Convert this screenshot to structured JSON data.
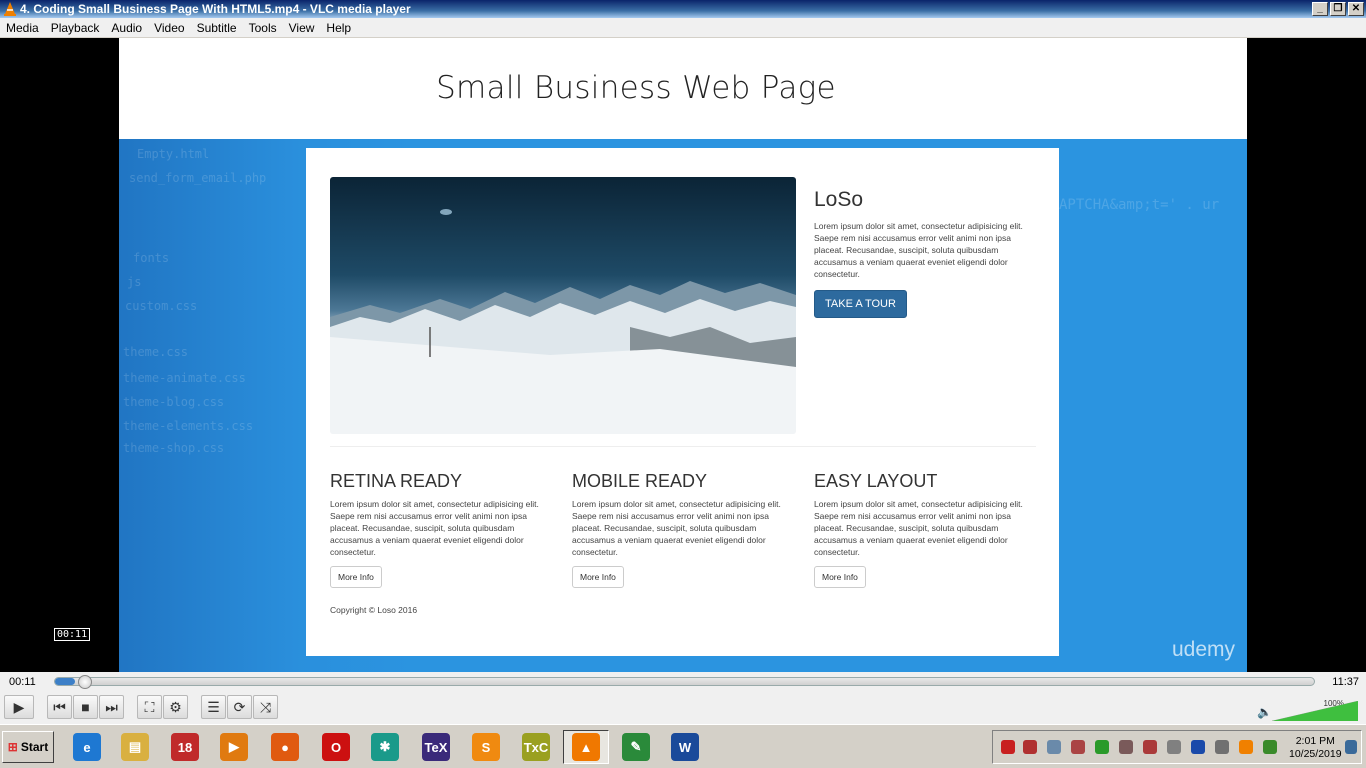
{
  "window": {
    "title": "4. Coding Small Business Page With HTML5.mp4 - VLC media player",
    "buttons": [
      "_",
      "❐",
      "✕"
    ]
  },
  "menu": [
    "Media",
    "Playback",
    "Audio",
    "Video",
    "Subtitle",
    "Tools",
    "View",
    "Help"
  ],
  "video": {
    "header_title": "Small Business Web Page",
    "watermark": "udemy",
    "hero": {
      "heading": "LoSo",
      "text": "Lorem ipsum dolor sit amet, consectetur adipisicing elit. Saepe rem nisi accusamus error velit animi non ipsa placeat. Recusandae, suscipit, soluta quibusdam accusamus a veniam quaerat eveniet eligendi dolor consectetur.",
      "button": "TAKE A TOUR"
    },
    "columns": [
      {
        "heading": "RETINA READY",
        "text": "Lorem ipsum dolor sit amet, consectetur adipisicing elit. Saepe rem nisi accusamus error velit animi non ipsa placeat. Recusandae, suscipit, soluta quibusdam accusamus a veniam quaerat eveniet eligendi dolor consectetur.",
        "button": "More Info"
      },
      {
        "heading": "MOBILE READY",
        "text": "Lorem ipsum dolor sit amet, consectetur adipisicing elit. Saepe rem nisi accusamus error velit animi non ipsa placeat. Recusandae, suscipit, soluta quibusdam accusamus a veniam quaerat eveniet eligendi dolor consectetur.",
        "button": "More Info"
      },
      {
        "heading": "EASY LAYOUT",
        "text": "Lorem ipsum dolor sit amet, consectetur adipisicing elit. Saepe rem nisi accusamus error velit animi non ipsa placeat. Recusandae, suscipit, soluta quibusdam accusamus a veniam quaerat eveniet eligendi dolor consectetur.",
        "button": "More Info"
      }
    ],
    "copyright": "Copyright © Loso 2016",
    "code_ghosts": [
      "Empty.html",
      "send_form_email.php",
      "fonts",
      "js",
      "custom.css",
      "theme.css",
      "theme-animate.css",
      "theme-blog.css",
      "theme-elements.css",
      "theme-shop.css"
    ],
    "code_bg_right": "APTCHA&amp;t='  . ur"
  },
  "player": {
    "hover_time": "00:11",
    "elapsed": "00:11",
    "total": "11:37",
    "progress": 0.016,
    "volume_label": "100%",
    "volume": 1.0,
    "controls": [
      "play-icon",
      "previous-icon",
      "stop-icon",
      "next-icon",
      "fullscreen-icon",
      "extended-settings-icon",
      "playlist-icon",
      "loop-icon",
      "shuffle-icon"
    ]
  },
  "taskbar": {
    "start_label": "Start",
    "apps": [
      {
        "name": "internet-explorer-icon",
        "glyph": "e",
        "color": "#1e78d2"
      },
      {
        "name": "file-explorer-icon",
        "glyph": "▤",
        "color": "#d9b040"
      },
      {
        "name": "app-18-icon",
        "glyph": "18",
        "color": "#c02a2a"
      },
      {
        "name": "media-player-icon",
        "glyph": "▶",
        "color": "#e07a10"
      },
      {
        "name": "firefox-icon",
        "glyph": "●",
        "color": "#e05a10"
      },
      {
        "name": "opera-icon",
        "glyph": "O",
        "color": "#cc1010"
      },
      {
        "name": "xmind-icon",
        "glyph": "✱",
        "color": "#1a9a8a"
      },
      {
        "name": "tex-icon",
        "glyph": "TeX",
        "color": "#3a2a7a"
      },
      {
        "name": "sublime-text-icon",
        "glyph": "S",
        "color": "#f08a10"
      },
      {
        "name": "texmaker-icon",
        "glyph": "TxC",
        "color": "#9aa020"
      },
      {
        "name": "vlc-icon",
        "glyph": "▲",
        "color": "#f07800"
      },
      {
        "name": "notepad-icon",
        "glyph": "✎",
        "color": "#2a8a3a"
      },
      {
        "name": "word-icon",
        "glyph": "W",
        "color": "#1a4a9a"
      }
    ],
    "clock_time": "2:01 PM",
    "clock_date": "10/25/2019"
  }
}
